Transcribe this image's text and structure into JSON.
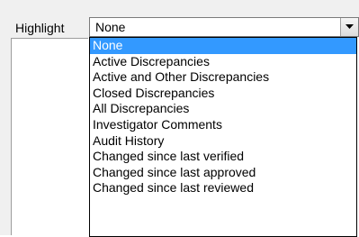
{
  "highlight": {
    "label": "Highlight",
    "selected_value": "None"
  },
  "dropdown": {
    "selected_index": 0,
    "options": [
      "None",
      "Active Discrepancies",
      "Active and Other Discrepancies",
      "Closed Discrepancies",
      "All Discrepancies",
      "Investigator Comments",
      "Audit History",
      "Changed since last verified",
      "Changed since last approved",
      "Changed since last reviewed"
    ]
  },
  "colors": {
    "selection": "#3399ff",
    "selection_text": "#ffffff",
    "chrome_background": "#f0f0f0"
  },
  "icons": {
    "combo_arrow": "chevron-down-icon"
  }
}
